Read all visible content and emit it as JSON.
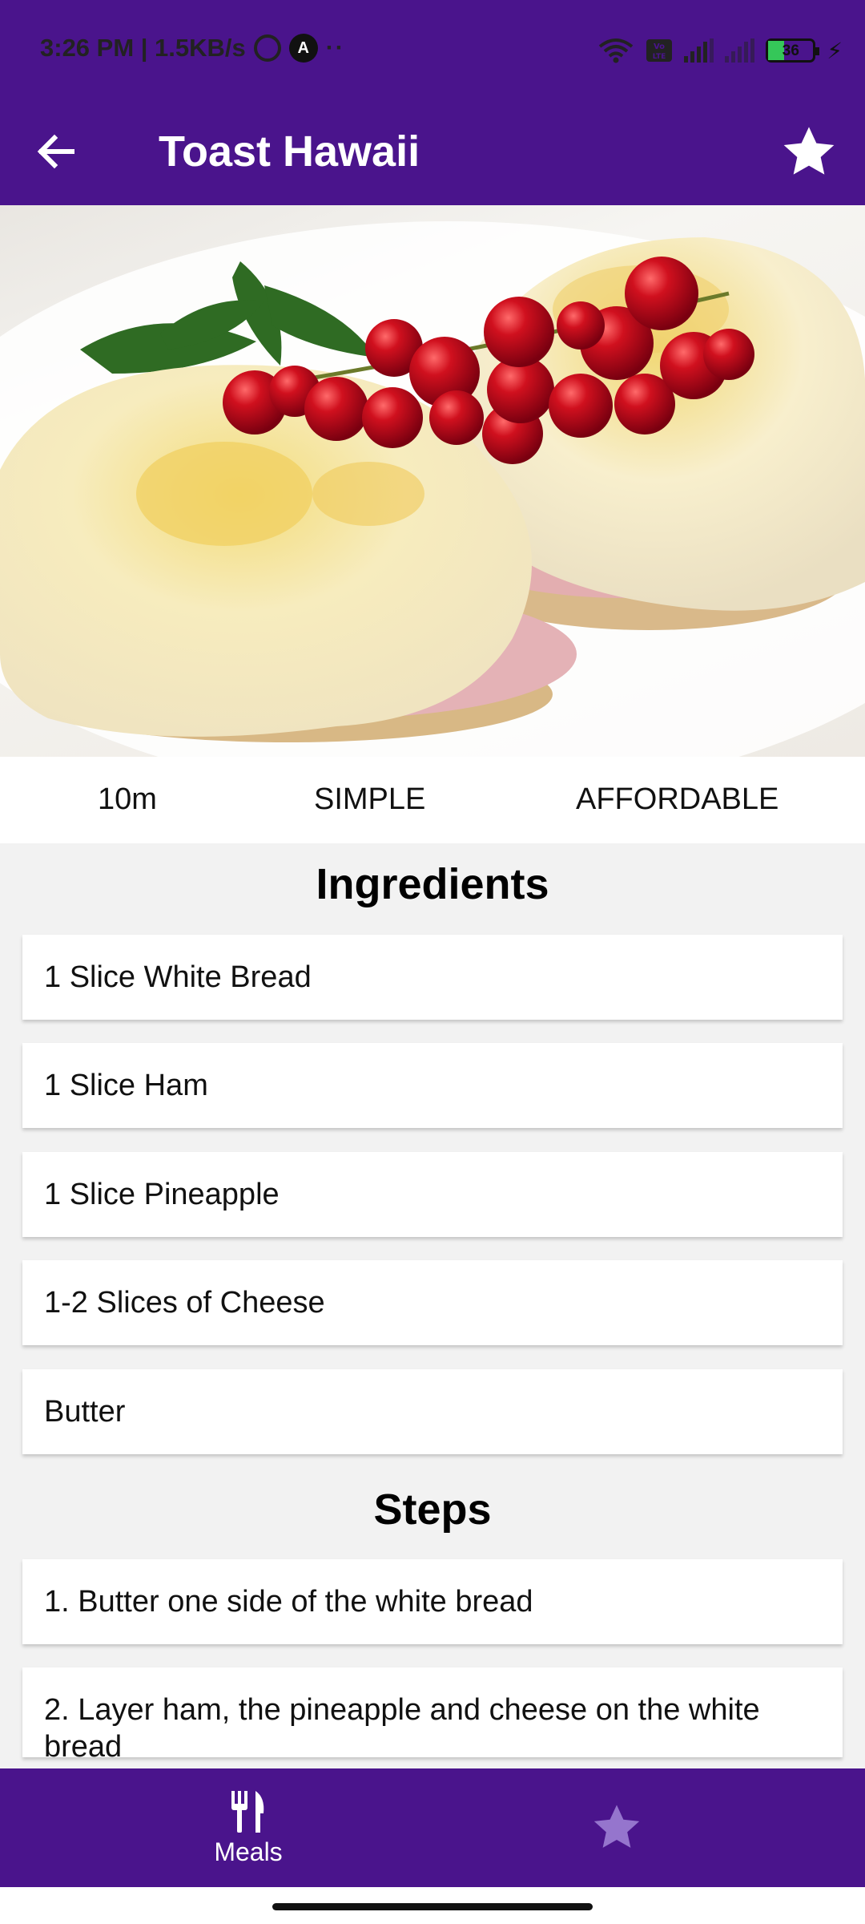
{
  "status_bar": {
    "time_speed": "3:26 PM | 1.5KB/s",
    "dots": "··",
    "battery": "36"
  },
  "app_bar": {
    "title": "Toast Hawaii"
  },
  "meta": {
    "duration": "10m",
    "complexity": "SIMPLE",
    "affordability": "AFFORDABLE"
  },
  "ingredients": {
    "title": "Ingredients",
    "items": [
      "1 Slice White Bread",
      "1 Slice Ham",
      "1 Slice Pineapple",
      "1-2 Slices of Cheese",
      "Butter"
    ]
  },
  "steps": {
    "title": "Steps",
    "items": [
      "1. Butter one side of the white bread",
      "2. Layer ham, the pineapple and cheese on the white bread"
    ]
  },
  "bottom_nav": {
    "meals_label": "Meals"
  },
  "colors": {
    "primary": "#4a148c",
    "inactive_icon": "#9575cd"
  }
}
